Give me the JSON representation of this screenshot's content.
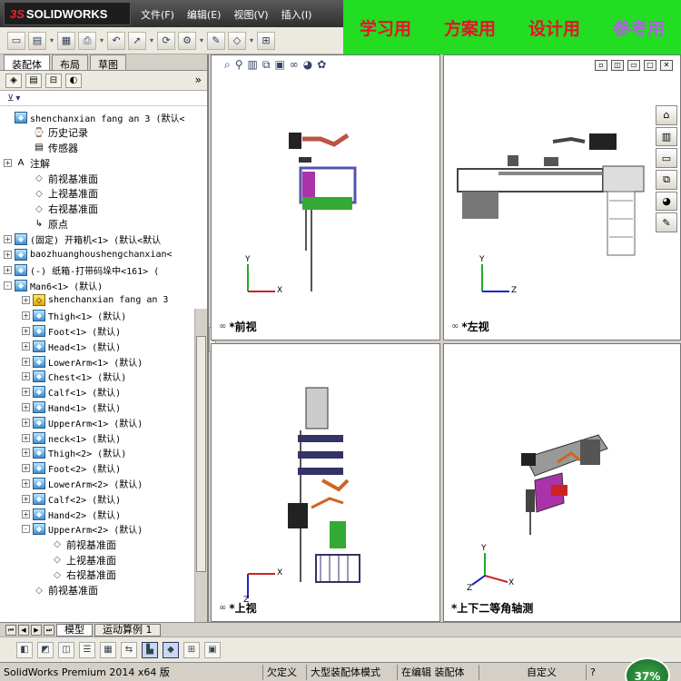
{
  "app": {
    "logo_text": "SOLIDWORKS",
    "logo_prefix": "3S"
  },
  "menu": [
    "文件(F)",
    "编辑(E)",
    "视图(V)",
    "插入(I)"
  ],
  "banner": {
    "items": [
      "学习用",
      "方案用",
      "设计用",
      "参考用"
    ]
  },
  "panel": {
    "tabs": [
      "装配体",
      "布局",
      "草图"
    ],
    "collapse": "»",
    "tree": [
      {
        "label": "shenchanxian fang an 3  (默认<",
        "icon": "asm",
        "exp": "none",
        "indent": 0
      },
      {
        "label": "历史记录",
        "icon": "history",
        "exp": "none",
        "indent": 1
      },
      {
        "label": "传感器",
        "icon": "sensor",
        "exp": "none",
        "indent": 1
      },
      {
        "label": "注解",
        "icon": "annotation",
        "exp": "+",
        "indent": 0
      },
      {
        "label": "前视基准面",
        "icon": "plane",
        "exp": "none",
        "indent": 1
      },
      {
        "label": "上视基准面",
        "icon": "plane",
        "exp": "none",
        "indent": 1
      },
      {
        "label": "右视基准面",
        "icon": "plane",
        "exp": "none",
        "indent": 1
      },
      {
        "label": "原点",
        "icon": "origin",
        "exp": "none",
        "indent": 1
      },
      {
        "label": "(固定) 开箱机<1> (默认<默认",
        "icon": "asm",
        "exp": "+",
        "indent": 0
      },
      {
        "label": "baozhuanghoushengchanxian<",
        "icon": "asm",
        "exp": "+",
        "indent": 0
      },
      {
        "label": "(-) 纸箱-打带码垛中<161> (",
        "icon": "asm",
        "exp": "+",
        "indent": 0
      },
      {
        "label": "Man6<1> (默认)",
        "icon": "asm",
        "exp": "-",
        "indent": 0
      },
      {
        "label": "shenchanxian fang an 3",
        "icon": "part",
        "exp": "+",
        "indent": 1
      },
      {
        "label": "Thigh<1> (默认)",
        "icon": "asm",
        "exp": "+",
        "indent": 1
      },
      {
        "label": "Foot<1> (默认)",
        "icon": "asm",
        "exp": "+",
        "indent": 1
      },
      {
        "label": "Head<1> (默认)",
        "icon": "asm",
        "exp": "+",
        "indent": 1
      },
      {
        "label": "LowerArm<1> (默认)",
        "icon": "asm",
        "exp": "+",
        "indent": 1
      },
      {
        "label": "Chest<1> (默认)",
        "icon": "asm",
        "exp": "+",
        "indent": 1
      },
      {
        "label": "Calf<1> (默认)",
        "icon": "asm",
        "exp": "+",
        "indent": 1
      },
      {
        "label": "Hand<1> (默认)",
        "icon": "asm",
        "exp": "+",
        "indent": 1
      },
      {
        "label": "UpperArm<1> (默认)",
        "icon": "asm",
        "exp": "+",
        "indent": 1
      },
      {
        "label": "neck<1> (默认)",
        "icon": "asm",
        "exp": "+",
        "indent": 1
      },
      {
        "label": "Thigh<2> (默认)",
        "icon": "asm",
        "exp": "+",
        "indent": 1
      },
      {
        "label": "Foot<2> (默认)",
        "icon": "asm",
        "exp": "+",
        "indent": 1
      },
      {
        "label": "LowerArm<2> (默认)",
        "icon": "asm",
        "exp": "+",
        "indent": 1
      },
      {
        "label": "Calf<2> (默认)",
        "icon": "asm",
        "exp": "+",
        "indent": 1
      },
      {
        "label": "Hand<2> (默认)",
        "icon": "asm",
        "exp": "+",
        "indent": 1
      },
      {
        "label": "UpperArm<2> (默认)",
        "icon": "asm",
        "exp": "-",
        "indent": 1
      },
      {
        "label": "前视基准面",
        "icon": "plane",
        "exp": "none",
        "indent": 2
      },
      {
        "label": "上视基准面",
        "icon": "plane",
        "exp": "none",
        "indent": 2
      },
      {
        "label": "右视基准面",
        "icon": "plane",
        "exp": "none",
        "indent": 2
      },
      {
        "label": "前视基准面",
        "icon": "plane",
        "exp": "none",
        "indent": 1
      }
    ]
  },
  "viewports": {
    "front": {
      "label": "*前视",
      "axis_y": "Y",
      "axis_x": "X"
    },
    "left": {
      "label": "*左视",
      "axis_y": "Y",
      "axis_x": "Z"
    },
    "top": {
      "label": "*上视",
      "axis_y": "Z",
      "axis_x": "X"
    },
    "iso": {
      "label": "*上下二等角轴测",
      "axis_y": "Y",
      "axis_x": "X",
      "axis_z": "Z"
    }
  },
  "bottom_tabs": [
    "模型",
    "运动算例 1"
  ],
  "status": {
    "product": "SolidWorks Premium 2014 x64 版",
    "state": "欠定义",
    "mode": "大型装配体模式",
    "editing": "在编辑 装配体",
    "custom": "自定义",
    "zoom": "37%"
  },
  "colors": {
    "banner_bg": "#22dd22",
    "banner_red": "#e8122c",
    "banner_purple": "#b060e0"
  }
}
